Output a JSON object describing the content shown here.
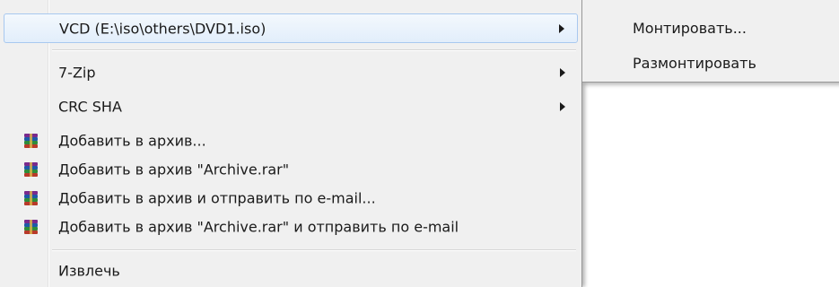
{
  "context_menu": {
    "items": [
      {
        "label": "VCD (E:\\iso\\others\\DVD1.iso)",
        "has_submenu": true,
        "highlighted": true
      },
      {
        "label": "7-Zip",
        "has_submenu": true
      },
      {
        "label": "CRC SHA",
        "has_submenu": true
      },
      {
        "label": "Добавить в архив...",
        "icon": "winrar-icon"
      },
      {
        "label": "Добавить в архив \"Archive.rar\"",
        "icon": "winrar-icon"
      },
      {
        "label": "Добавить в архив и отправить по e-mail...",
        "icon": "winrar-icon"
      },
      {
        "label": "Добавить в архив \"Archive.rar\" и отправить по e-mail",
        "icon": "winrar-icon"
      },
      {
        "label": "Извлечь"
      }
    ]
  },
  "submenu": {
    "items": [
      {
        "label": "Монтировать..."
      },
      {
        "label": "Размонтировать"
      }
    ]
  },
  "colors": {
    "menu_background": "#f0f0f0",
    "highlight_border": "#a8c8ef",
    "highlight_fill": "#e2eefb"
  }
}
